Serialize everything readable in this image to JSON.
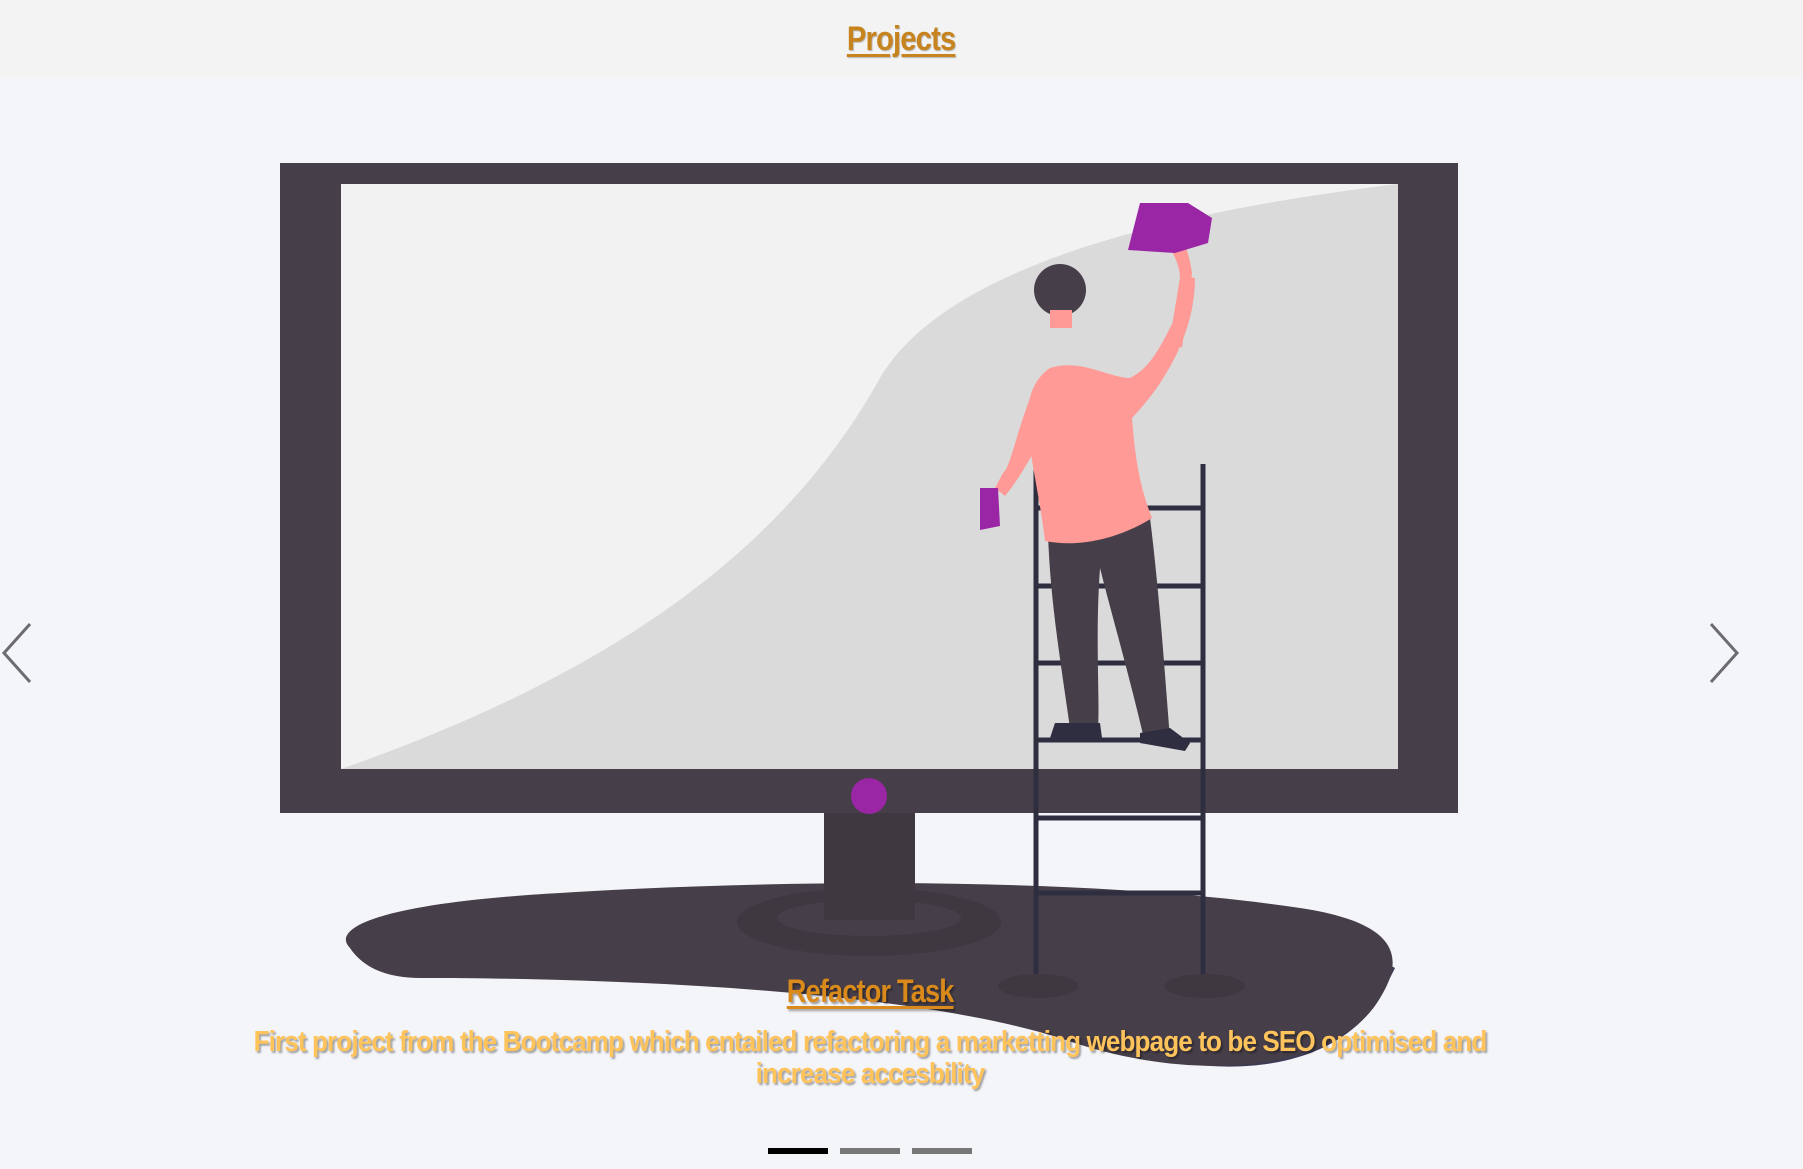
{
  "header": {
    "link_label": "Projects"
  },
  "carousel": {
    "prev_icon": "chevron-left-icon",
    "next_icon": "chevron-right-icon",
    "active_slide": 1,
    "slide_count": 3,
    "slides": [
      {
        "title": "Refactor Task",
        "description": "First project from the Bootcamp which entailed refactoring a marketting webpage to be SEO optimised and increase accesbility"
      }
    ]
  },
  "colors": {
    "header_bg": "#f3f3f3",
    "title_orange": "#c7841e",
    "caption_yellow": "#ffc35c",
    "monitor_dark": "#463e48",
    "accent_purple": "#9a26a5",
    "shirt_pink": "#ff9a96"
  }
}
